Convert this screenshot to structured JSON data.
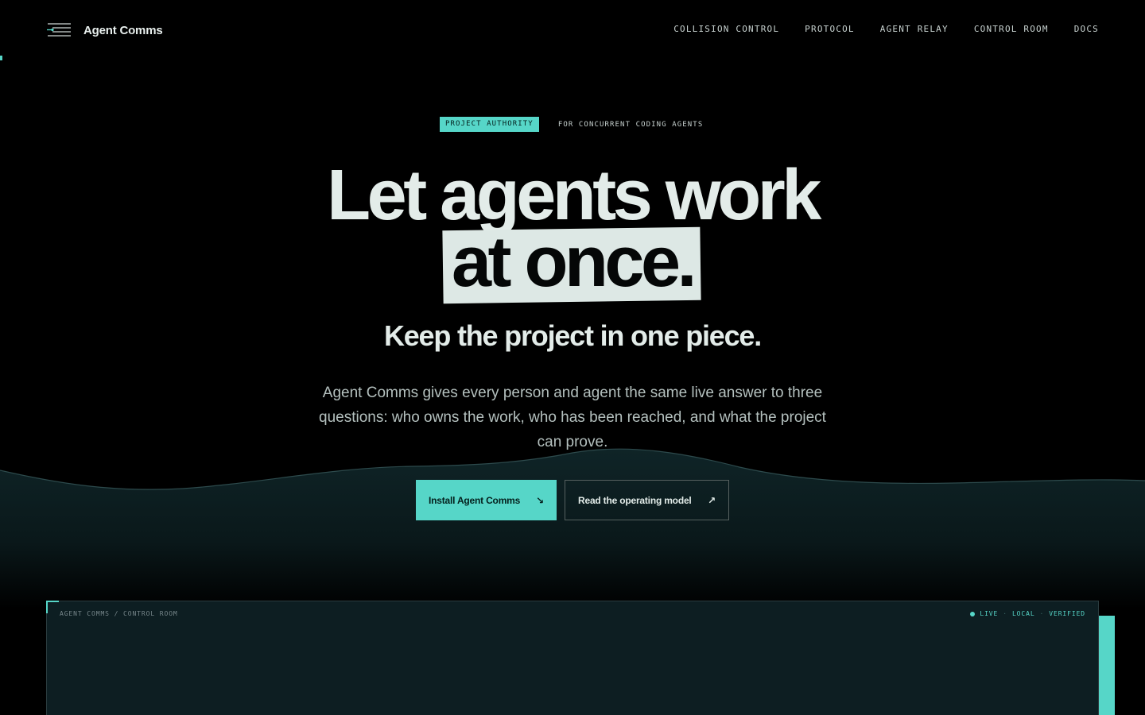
{
  "brand": {
    "name": "Agent Comms",
    "icon": "signal-lines-icon"
  },
  "nav": {
    "items": [
      "COLLISION CONTROL",
      "PROTOCOL",
      "AGENT RELAY",
      "CONTROL ROOM",
      "DOCS"
    ]
  },
  "hero": {
    "badge": "PROJECT AUTHORITY",
    "kicker": "FOR CONCURRENT CODING AGENTS",
    "headline_line1": "Let agents work",
    "headline_line2": "at once.",
    "subhead": "Keep the project in one piece.",
    "lede": "Agent Comms gives every person and agent the same live answer to three questions: who owns the work, who has been reached, and what the project can prove."
  },
  "actions": {
    "primary_label": "Install Agent Comms",
    "primary_icon": "arrow-down-right-icon",
    "secondary_label": "Read the operating model",
    "secondary_icon": "arrow-up-right-icon"
  },
  "panel": {
    "breadcrumb": "AGENT COMMS / CONTROL ROOM",
    "status": [
      "LIVE",
      "LOCAL",
      "VERIFIED"
    ]
  },
  "colors": {
    "accent": "#56d6c8",
    "background": "#000000",
    "panel": "#0d1e22",
    "highlight": "#dde8e5"
  }
}
